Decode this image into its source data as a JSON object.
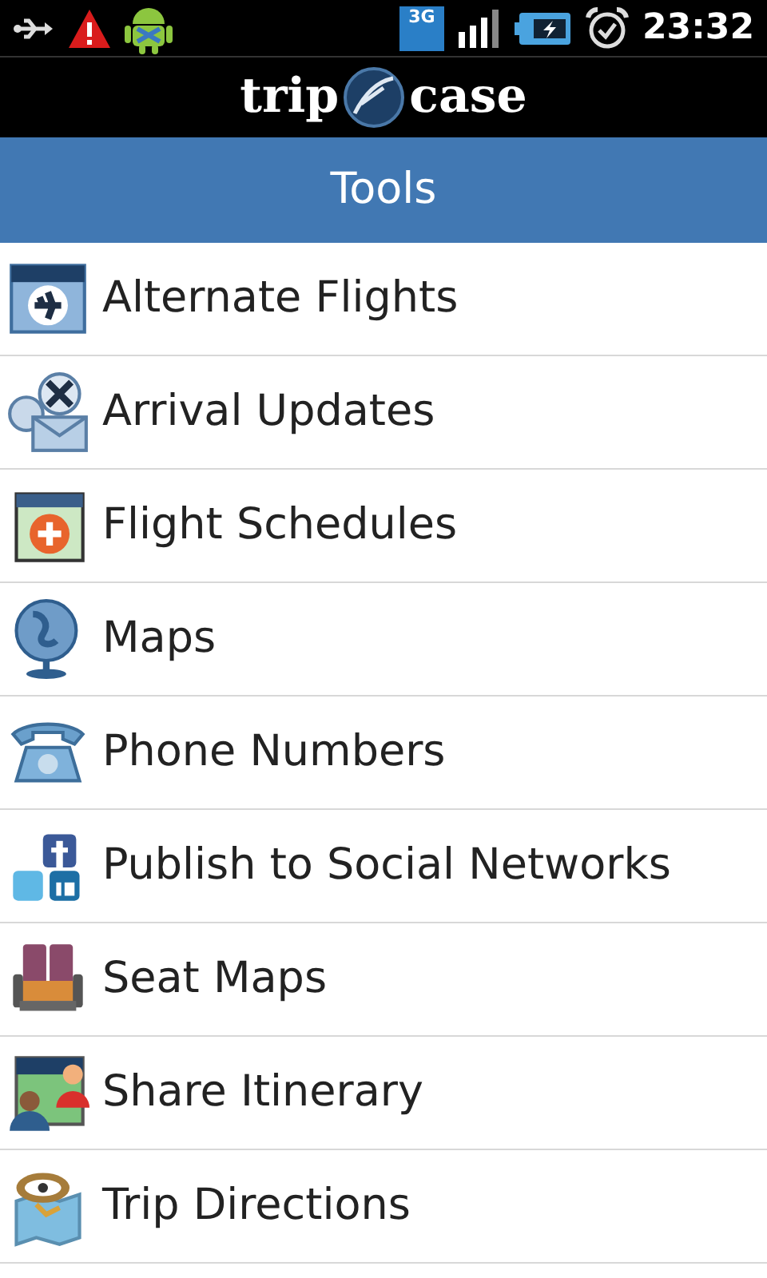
{
  "status_bar": {
    "network_type": "3G",
    "time": "23:32"
  },
  "logo": {
    "left": "trip",
    "right": "case"
  },
  "header": {
    "title": "Tools"
  },
  "items": [
    {
      "label": "Alternate Flights"
    },
    {
      "label": "Arrival Updates"
    },
    {
      "label": "Flight Schedules"
    },
    {
      "label": "Maps"
    },
    {
      "label": "Phone Numbers"
    },
    {
      "label": "Publish to Social Networks"
    },
    {
      "label": "Seat Maps"
    },
    {
      "label": "Share Itinerary"
    },
    {
      "label": "Trip Directions"
    }
  ]
}
